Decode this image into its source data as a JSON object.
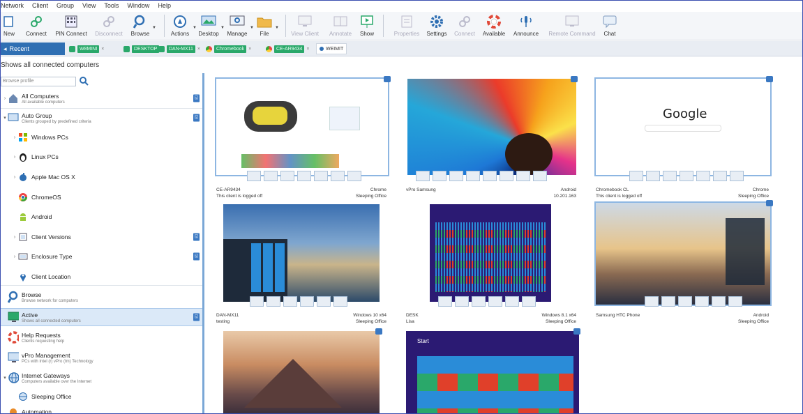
{
  "menu": [
    "Network",
    "Client",
    "Group",
    "View",
    "Tools",
    "Window",
    "Help"
  ],
  "toolbar": {
    "new": "New",
    "connect": "Connect",
    "pin_connect": "PIN Connect",
    "disconnect": "Disconnect",
    "browse": "Browse",
    "actions": "Actions",
    "desktop": "Desktop",
    "manage": "Manage",
    "file": "File",
    "view_client": "View Client",
    "annotate": "Annotate",
    "show": "Show",
    "properties": "Properties",
    "settings": "Settings",
    "connect2": "Connect",
    "available": "Available",
    "announce": "Announce",
    "remote_command": "Remote Command",
    "chat": "Chat"
  },
  "tabs": {
    "recent": "Recent",
    "clients": [
      "W8MINI",
      "DESKTOP",
      "DAN-MX11",
      "Chromebook",
      "CE-AR9434",
      "WEIMIT"
    ]
  },
  "info": "Shows all connected computers",
  "sidebar": {
    "search_placeholder": "Browse profile",
    "items": [
      {
        "label": "All Computers",
        "sub": "All available computers"
      },
      {
        "label": "Auto Group",
        "sub": "Clients grouped by predefined criteria"
      },
      {
        "label": "Windows PCs"
      },
      {
        "label": "Linux PCs"
      },
      {
        "label": "Apple Mac OS X"
      },
      {
        "label": "ChromeOS"
      },
      {
        "label": "Android"
      },
      {
        "label": "Client Versions"
      },
      {
        "label": "Enclosure Type"
      },
      {
        "label": "Client Location"
      },
      {
        "label": "Browse",
        "sub": "Browse network for computers"
      },
      {
        "label": "Active",
        "sub": "Shows all connected computers"
      },
      {
        "label": "Help Requests",
        "sub": "Clients requesting help"
      },
      {
        "label": "vPro Management",
        "sub": "PCs with Intel (r) vPro (tm) Technology"
      },
      {
        "label": "Internet Gateways",
        "sub": "Computers available over the Internet"
      },
      {
        "label": "Sleeping Office"
      },
      {
        "label": "Automation"
      }
    ]
  },
  "tiles": [
    {
      "name": "CE-AR9434",
      "os": "Chrome",
      "status": "This client is logged off",
      "group": "Sleeping Office"
    },
    {
      "name": "vPro Samsung",
      "os": "Android",
      "status": "",
      "group": "10.201.163"
    },
    {
      "name": "Chromebook CL",
      "os": "Chrome",
      "status": "This client is logged off",
      "group": "Sleeping Office"
    },
    {
      "name": "DAN-MX11",
      "os": "Windows 10 x64",
      "status": "testing",
      "group": "Sleeping Office"
    },
    {
      "name": "DESK",
      "os": "Windows 8.1 x64",
      "status": "Lisa",
      "group": "Sleeping Office"
    },
    {
      "name": "Samsung HTC Phone",
      "os": "Android",
      "status": "",
      "group": "Sleeping Office"
    }
  ],
  "screens": {
    "google": "Google",
    "start": "Start"
  },
  "colors": {
    "accent": "#2f6fb3",
    "tab_green": "#2aa86a",
    "selection": "#8db6e2"
  }
}
